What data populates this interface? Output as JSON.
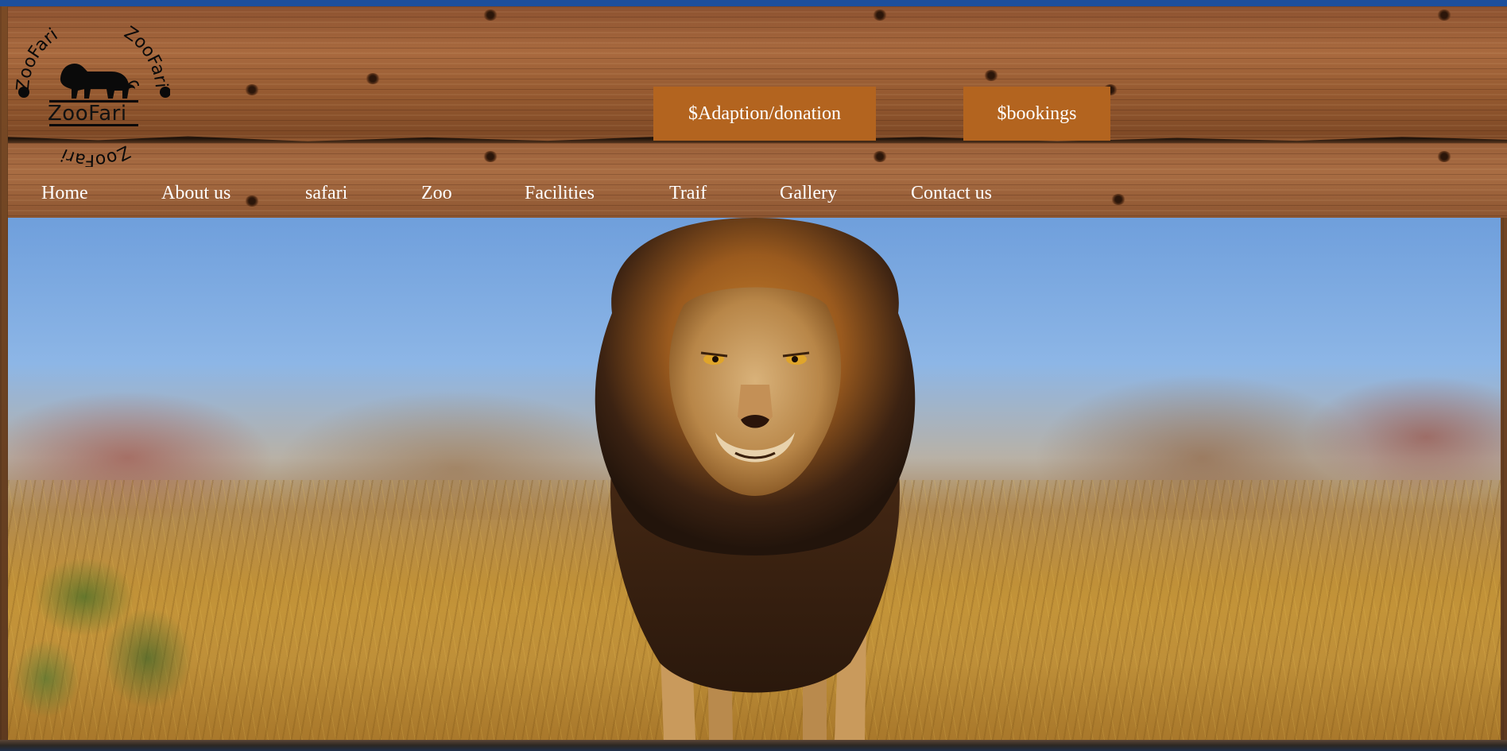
{
  "brand": {
    "logo_word": "ZooFari",
    "ring_text": "ZooFari",
    "logo_icon": "lion-silhouette-icon"
  },
  "actions": {
    "donation_label": "$Adaption/donation",
    "bookings_label": "$bookings"
  },
  "nav": {
    "items": [
      "Home",
      "About us",
      "safari",
      "Zoo",
      "Facilities",
      "Traif",
      "Gallery",
      "Contact us"
    ]
  },
  "hero": {
    "subject": "lion-hero-image"
  },
  "colors": {
    "button_bg": "#b3641f",
    "text_light": "#ffffff",
    "frame_blue": "#1f4a8c"
  }
}
